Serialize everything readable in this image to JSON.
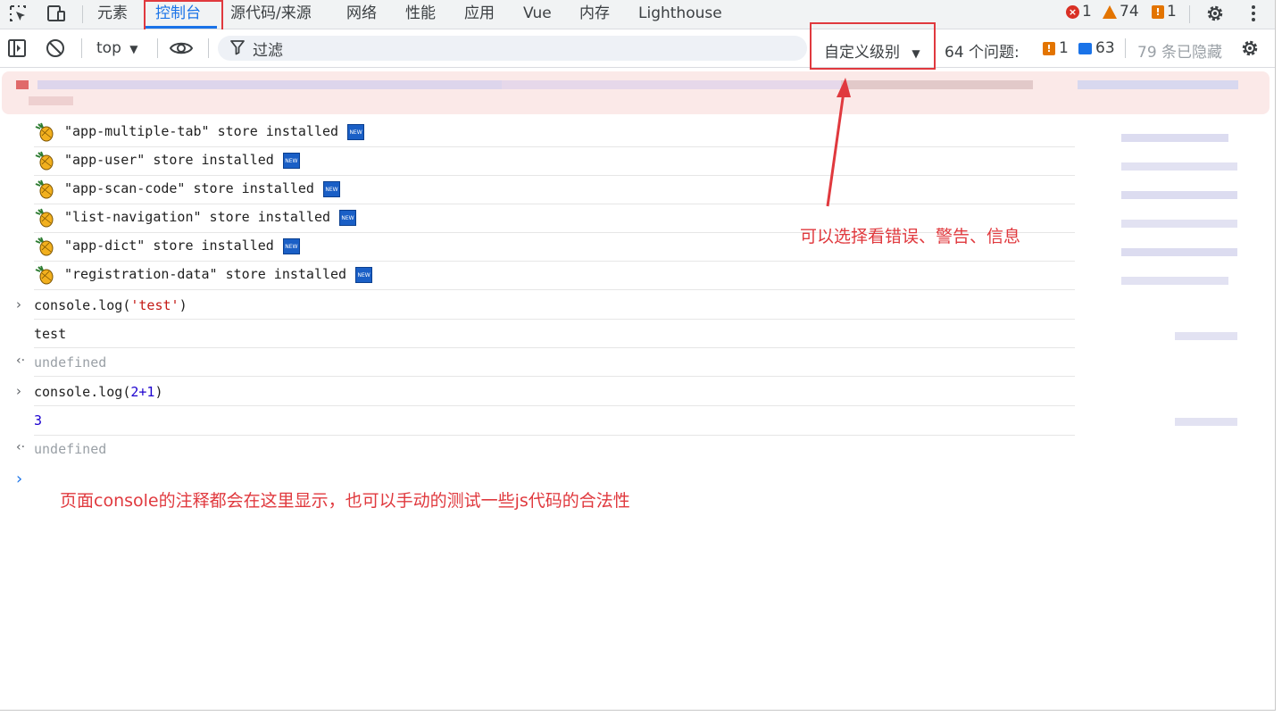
{
  "tabs": [
    "元素",
    "控制台",
    "源代码/来源",
    "网络",
    "性能",
    "应用",
    "Vue",
    "内存",
    "Lighthouse"
  ],
  "counts": {
    "errors": "1",
    "warnings": "74",
    "issues": "1"
  },
  "toolbar": {
    "context": "top",
    "filter_placeholder": "过滤",
    "levels": "自定义级别",
    "issues_label": "64 个问题:",
    "issues_warn": "1",
    "issues_info": "63",
    "hidden": "79 条已隐藏"
  },
  "stores": [
    {
      "text": "\"app-multiple-tab\" store installed",
      "badge": "NEW"
    },
    {
      "text": "\"app-user\" store installed",
      "badge": "NEW"
    },
    {
      "text": "\"app-scan-code\" store installed",
      "badge": "NEW"
    },
    {
      "text": "\"list-navigation\" store installed",
      "badge": "NEW"
    },
    {
      "text": "\"app-dict\" store installed",
      "badge": "NEW"
    },
    {
      "text": "\"registration-data\" store installed",
      "badge": "NEW"
    }
  ],
  "console": {
    "cmd1_fn": "console.log(",
    "cmd1_arg": "'test'",
    "cmd1_close": ")",
    "out1": "test",
    "ret1": "undefined",
    "cmd2_fn": "console.log(",
    "cmd2_arg": "2+1",
    "cmd2_close": ")",
    "out2": "3",
    "ret2": "undefined"
  },
  "annotations": {
    "levels_note": "可以选择看错误、警告、信息",
    "console_note": "页面console的注释都会在这里显示，也可以手动的测试一些js代码的合法性"
  },
  "colors": {
    "accent": "#1a73e8",
    "annotation": "#e0393e",
    "error": "#d93025",
    "warning": "#e37400"
  }
}
